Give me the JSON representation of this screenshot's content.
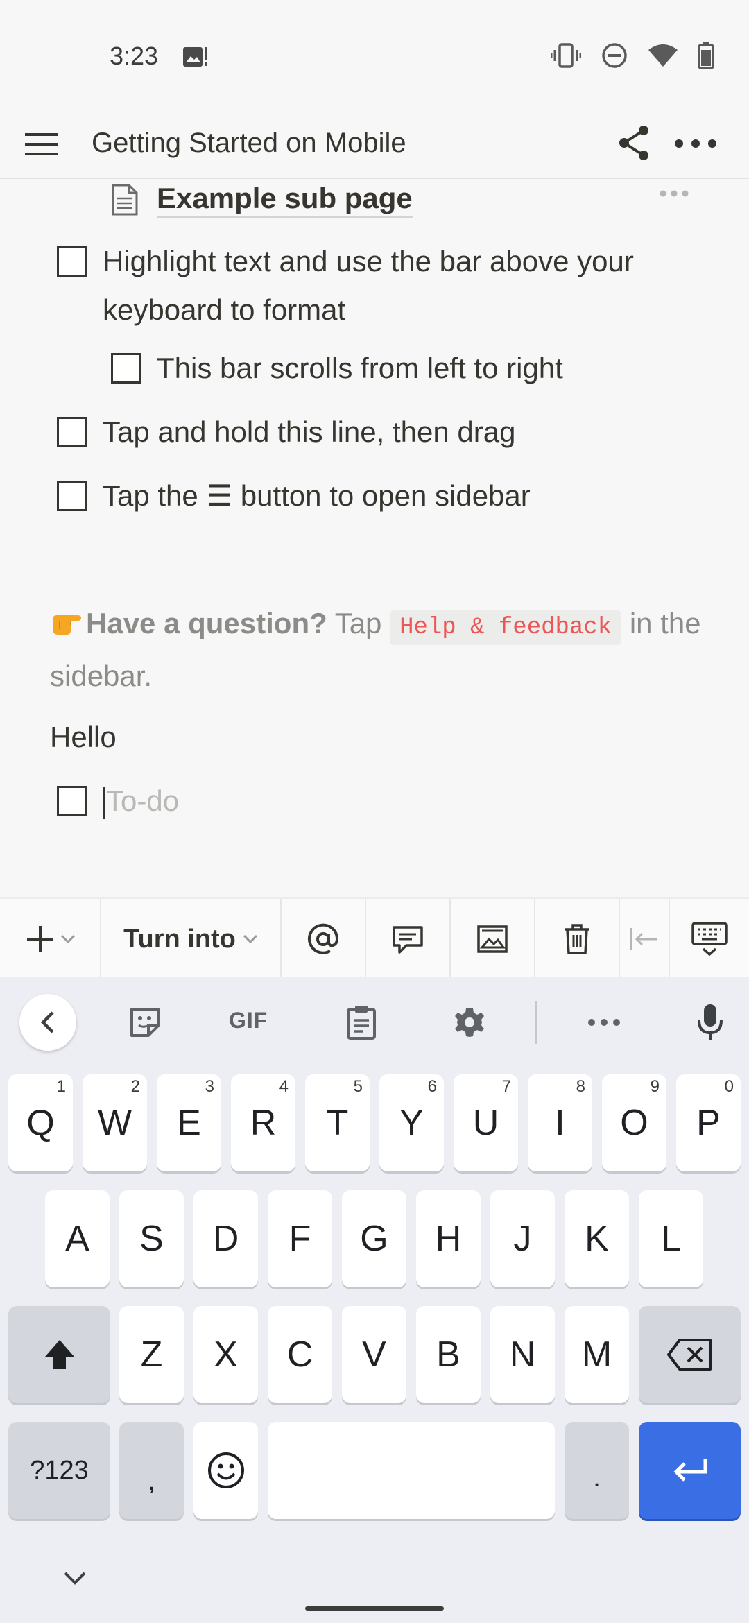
{
  "status_bar": {
    "time": "3:23"
  },
  "header": {
    "title": "Getting Started on Mobile"
  },
  "content": {
    "subpage_label": "Example sub page",
    "todos": [
      {
        "text": "Highlight text and use the bar above your keyboard to format"
      },
      {
        "text": "This bar scrolls from left to right"
      },
      {
        "text": "Tap and hold this line, then drag"
      },
      {
        "text": "Tap the ☰ button to open sidebar"
      }
    ],
    "question": {
      "bold": "Have a question?",
      "tap": "Tap",
      "chip": "Help & feedback",
      "rest": "in the sidebar."
    },
    "hello": "Hello",
    "new_todo_placeholder": "To-do"
  },
  "toolbar": {
    "turn_into": "Turn into"
  },
  "keyboard": {
    "gif_label": "GIF",
    "row1": [
      {
        "k": "Q",
        "h": "1"
      },
      {
        "k": "W",
        "h": "2"
      },
      {
        "k": "E",
        "h": "3"
      },
      {
        "k": "R",
        "h": "4"
      },
      {
        "k": "T",
        "h": "5"
      },
      {
        "k": "Y",
        "h": "6"
      },
      {
        "k": "U",
        "h": "7"
      },
      {
        "k": "I",
        "h": "8"
      },
      {
        "k": "O",
        "h": "9"
      },
      {
        "k": "P",
        "h": "0"
      }
    ],
    "row2": [
      "A",
      "S",
      "D",
      "F",
      "G",
      "H",
      "J",
      "K",
      "L"
    ],
    "row3": [
      "Z",
      "X",
      "C",
      "V",
      "B",
      "N",
      "M"
    ],
    "symbols_label": "?123",
    "comma": ",",
    "period": "."
  },
  "colors": {
    "enter_key": "#3a6ee4",
    "code_text": "#eb5757"
  }
}
